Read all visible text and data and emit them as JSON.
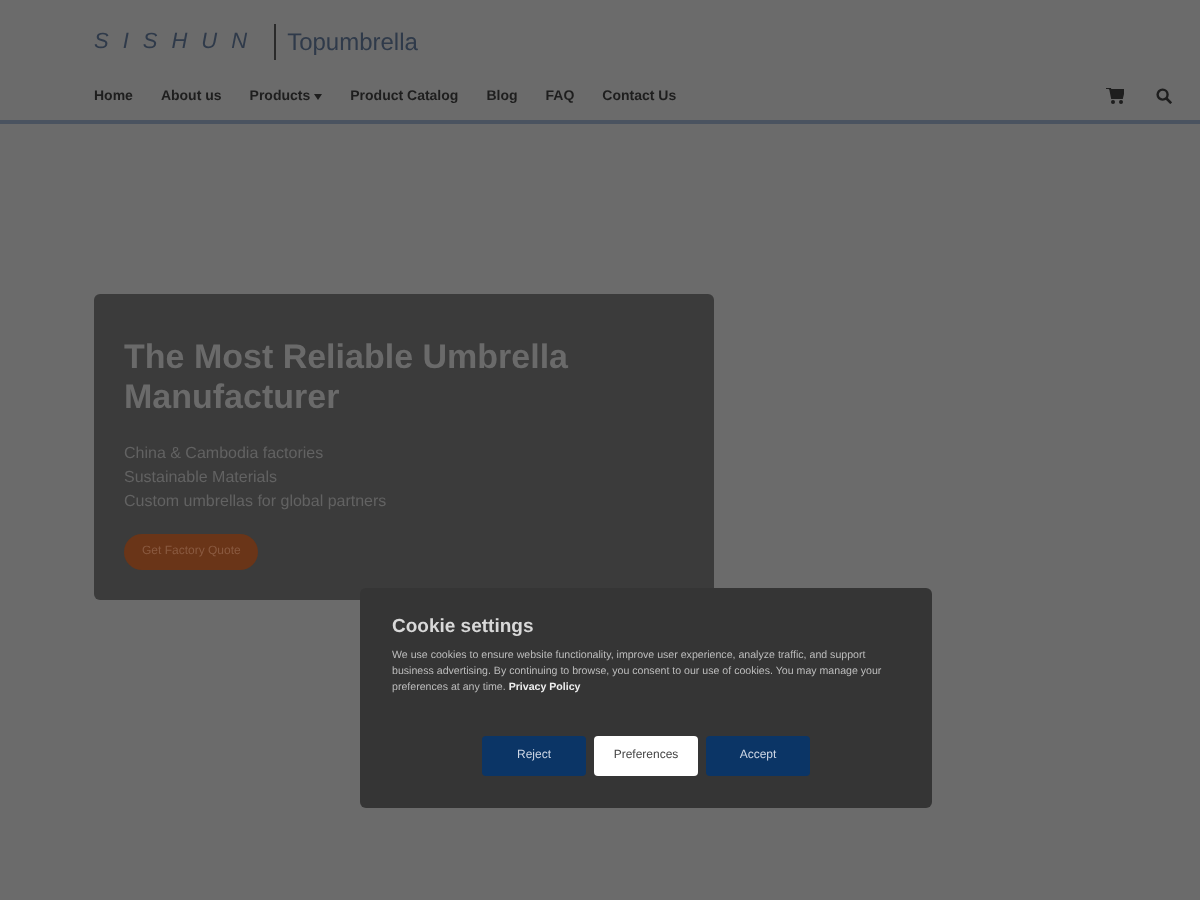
{
  "logo": {
    "brand": "SISHUN",
    "sub_brand": "Topumbrella"
  },
  "nav": [
    {
      "label": "Home",
      "kind": "link"
    },
    {
      "label": "About us",
      "kind": "link"
    },
    {
      "label": "Products",
      "kind": "dropdown"
    },
    {
      "label": "Product Catalog",
      "kind": "link"
    },
    {
      "label": "Blog",
      "kind": "link"
    },
    {
      "label": "FAQ",
      "kind": "link"
    },
    {
      "label": "Contact Us",
      "kind": "link"
    }
  ],
  "hero": {
    "title": "The Most Reliable Umbrella Manufacturer",
    "lines": [
      "China & Cambodia factories",
      "Sustainable Materials",
      "Custom umbrellas for global partners"
    ],
    "button": "Get Factory Quote"
  },
  "cookie_dialog": {
    "title": "Cookie settings",
    "text": "We use cookies to ensure website functionality, improve user experience, analyze traffic, and support business advertising. By continuing to browse, you consent to our use of cookies. You may manage your preferences at any time.",
    "link": "Privacy Policy",
    "buttons": [
      {
        "label": "Reject",
        "kind": "primary"
      },
      {
        "label": "Preferences",
        "kind": "secondary"
      },
      {
        "label": "Accept",
        "kind": "primary"
      }
    ]
  }
}
